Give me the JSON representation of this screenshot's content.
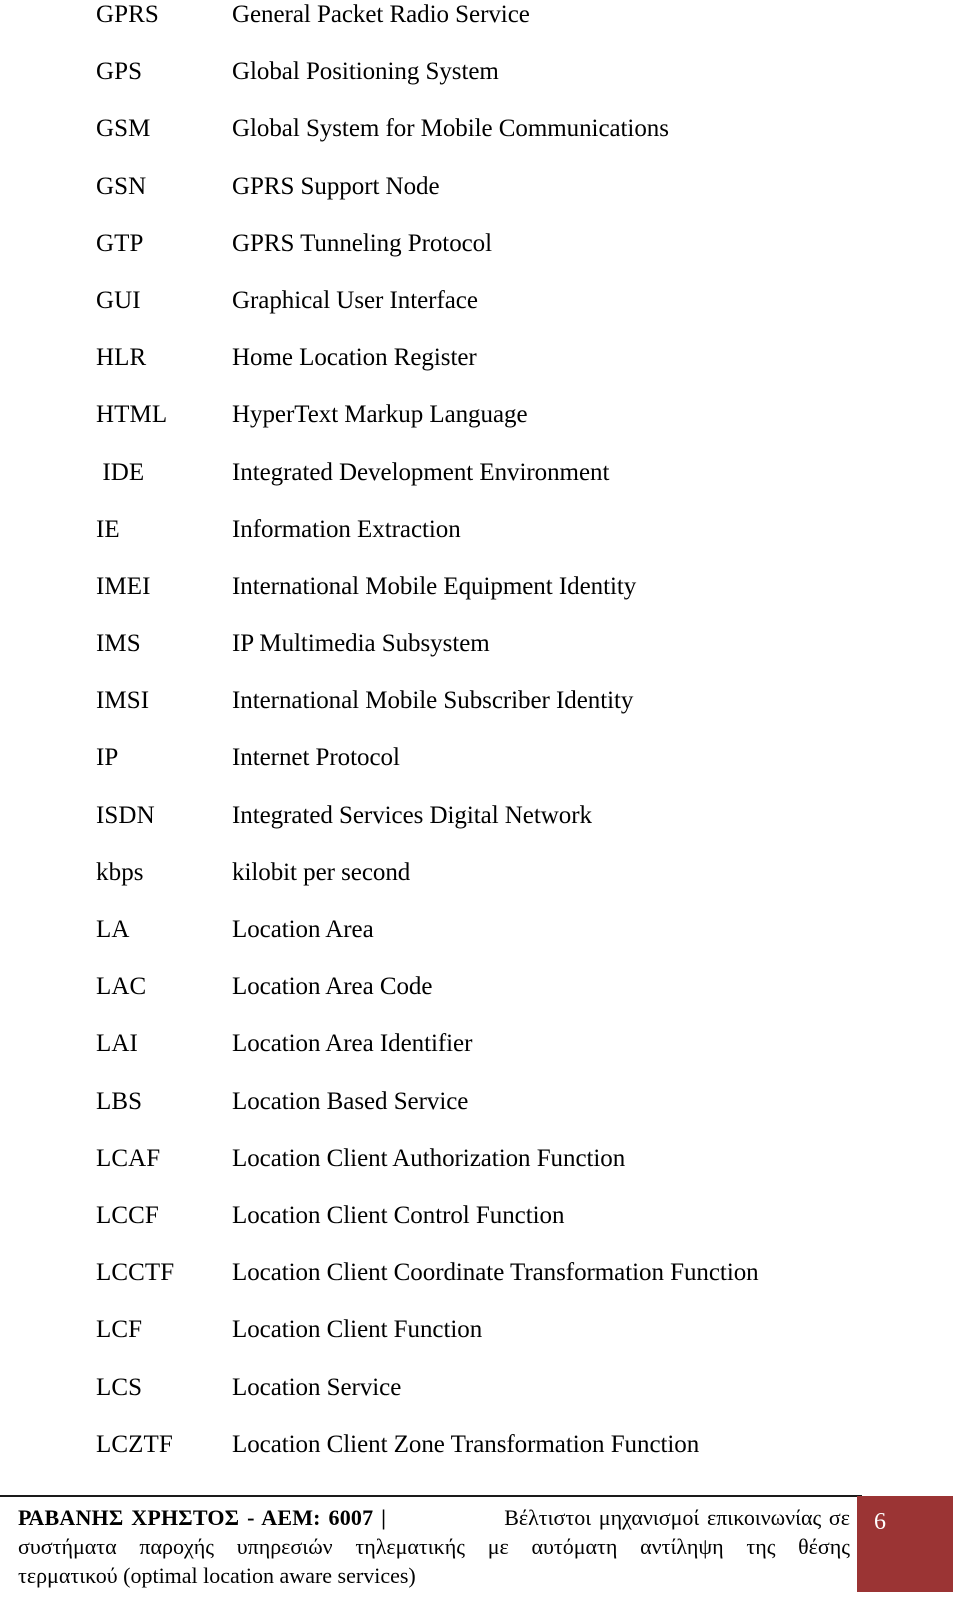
{
  "document": {
    "type": "abbreviations-glossary",
    "page_number": "6"
  },
  "glossary": {
    "entries": [
      {
        "term": "GPRS",
        "definition": "General Packet Radio Service"
      },
      {
        "term": "GPS",
        "definition": "Global Positioning System"
      },
      {
        "term": "GSM",
        "definition": "Global System for Mobile Communications"
      },
      {
        "term": "GSN",
        "definition": "GPRS Support Node"
      },
      {
        "term": "GTP",
        "definition": "GPRS Tunneling Protocol"
      },
      {
        "term": "GUI",
        "definition": "Graphical User Interface"
      },
      {
        "term": "HLR",
        "definition": "Home Location Register"
      },
      {
        "term": "HTML",
        "definition": "HyperText Markup Language"
      },
      {
        "term": " IDE",
        "definition": "Integrated Development Environment"
      },
      {
        "term": "IE",
        "definition": "Information Extraction"
      },
      {
        "term": "IMEI",
        "definition": "International Mobile Equipment Identity"
      },
      {
        "term": "IMS",
        "definition": "IP Multimedia Subsystem"
      },
      {
        "term": "IMSI",
        "definition": "International Mobile Subscriber Identity"
      },
      {
        "term": "IP",
        "definition": "Internet Protocol"
      },
      {
        "term": "ISDN",
        "definition": "Integrated Services Digital Network"
      },
      {
        "term": "kbps",
        "definition": "kilobit per second"
      },
      {
        "term": "LA",
        "definition": "Location Area"
      },
      {
        "term": "LAC",
        "definition": "Location Area Code"
      },
      {
        "term": "LAI",
        "definition": "Location Area Identifier"
      },
      {
        "term": "LBS",
        "definition": "Location Based Service"
      },
      {
        "term": "LCAF",
        "definition": "Location Client Authorization Function"
      },
      {
        "term": "LCCF",
        "definition": "Location Client Control Function"
      },
      {
        "term": "LCCTF",
        "definition": "Location Client Coordinate Transformation Function"
      },
      {
        "term": "LCF",
        "definition": "Location Client Function"
      },
      {
        "term": "LCS",
        "definition": "Location Service"
      },
      {
        "term": "LCZTF",
        "definition": "Location Client Zone Transformation Function"
      }
    ]
  },
  "footer": {
    "author": "ΡΑΒΑΝΗΣ ΧΡΗΣΤΟΣ - ΑΕΜ: 6007 |",
    "title_line1": "Βέλτιστοι μηχανισμοί επικοινωνίας σε",
    "title_line2": "συστήματα παροχής υπηρεσιών τηλεματικής με αυτόματη αντίληψη της θέσης",
    "title_line3": "τερματικού (optimal location aware services)",
    "page_number": "6",
    "accent_color": "#9b3434",
    "rule_color": "#1a1a1a"
  }
}
